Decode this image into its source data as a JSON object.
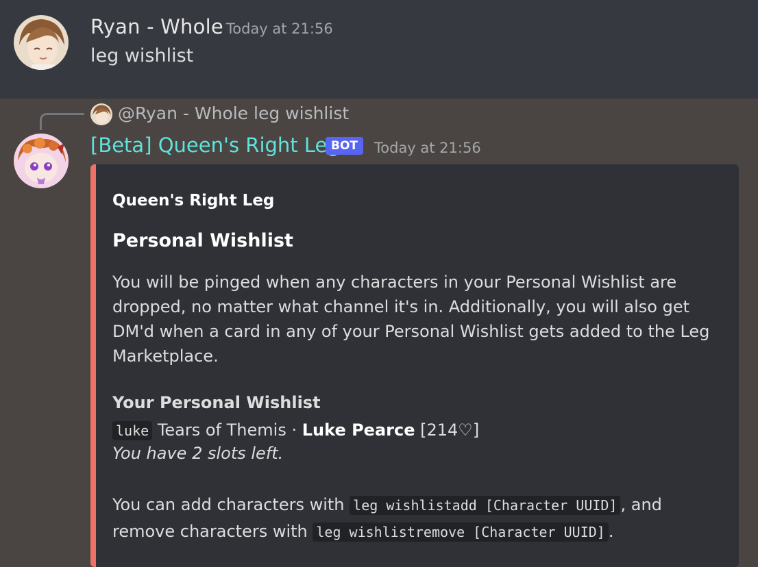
{
  "message1": {
    "username": "Ryan - Whole",
    "timestamp": "Today at 21:56",
    "content": "leg wishlist"
  },
  "message2": {
    "reply": {
      "mention": "@Ryan - Whole",
      "content": "leg wishlist"
    },
    "username": "[Beta] Queen's Right Leg",
    "badge": "BOT",
    "timestamp": "Today at 21:56",
    "embed": {
      "accent_color": "#ee7268",
      "author": "Queen's Right Leg",
      "title": "Personal Wishlist",
      "description": "You will be pinged when any characters in your Personal Wishlist are dropped, no matter what channel it's in. Additionally, you will also get DM'd when a card in any of your Personal Wishlist gets added to the Leg Marketplace.",
      "field_name": "Your Personal Wishlist",
      "wishlist": [
        {
          "code": "luke",
          "series": "Tears of Themis",
          "separator": "·",
          "character": "Luke Pearce",
          "hearts": "[214♡]"
        }
      ],
      "slots_left": "You have 2 slots left.",
      "footer": {
        "text1": "You can add characters with",
        "code1": "leg wishlistadd [Character UUID]",
        "text2": ", and remove characters with",
        "code2": "leg wishlistremove [Character UUID]",
        "text3": "."
      }
    }
  },
  "colors": {
    "bot_name": "#5fe3dc",
    "badge": "#5865f2",
    "embed_bg": "#2f3136"
  }
}
